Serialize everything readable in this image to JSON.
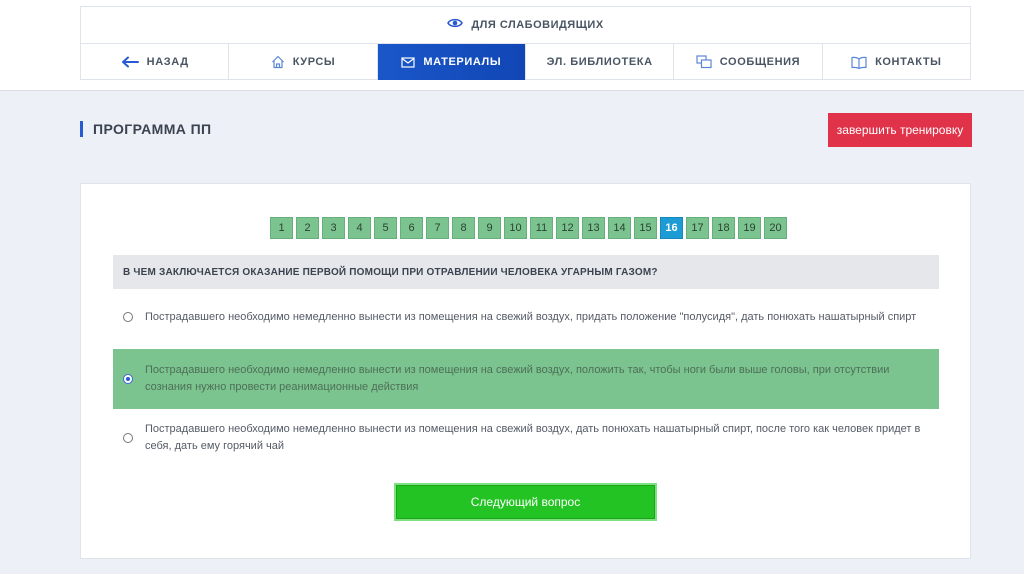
{
  "header": {
    "accessibility_label": "ДЛЯ СЛАБОВИДЯЩИХ",
    "nav": [
      {
        "label": "НАЗАД",
        "icon": "arrow-left-icon"
      },
      {
        "label": "КУРСЫ",
        "icon": "home-icon"
      },
      {
        "label": "МАТЕРИАЛЫ",
        "icon": "envelope-icon",
        "active": true
      },
      {
        "label": "ЭЛ. БИБЛИОТЕКА"
      },
      {
        "label": "СООБЩЕНИЯ",
        "icon": "messages-icon"
      },
      {
        "label": "КОНТАКТЫ",
        "icon": "book-icon"
      }
    ]
  },
  "page": {
    "title": "ПРОГРАММА ПП",
    "finish_button": "завершить тренировку"
  },
  "quiz": {
    "pages": [
      "1",
      "2",
      "3",
      "4",
      "5",
      "6",
      "7",
      "8",
      "9",
      "10",
      "11",
      "12",
      "13",
      "14",
      "15",
      "16",
      "17",
      "18",
      "19",
      "20"
    ],
    "current_page": "16",
    "question": "В ЧЕМ ЗАКЛЮЧАЕТСЯ ОКАЗАНИЕ ПЕРВОЙ ПОМОЩИ ПРИ ОТРАВЛЕНИИ ЧЕЛОВЕКА УГАРНЫМ ГАЗОМ?",
    "answers": [
      {
        "text": "Пострадавшего необходимо немедленно вынести из помещения на свежий воздух, придать положение \"полусидя\", дать понюхать нашатырный спирт",
        "selected": false
      },
      {
        "text": "Пострадавшего необходимо немедленно вынести из помещения на свежий воздух, положить так, чтобы ноги были выше головы, при отсутствии сознания нужно провести реанимационные действия",
        "selected": true
      },
      {
        "text": "Пострадавшего необходимо немедленно вынести из помещения на свежий воздух, дать понюхать нашатырный спирт, после того как человек придет в себя, дать ему горячий чай",
        "selected": false
      }
    ],
    "next_button": "Следующий вопрос"
  },
  "colors": {
    "accent_blue": "#1a57c9",
    "finish_red": "#e0334a",
    "page_green": "#7cc48f",
    "page_current": "#1c9bd4",
    "next_green": "#22c322"
  }
}
